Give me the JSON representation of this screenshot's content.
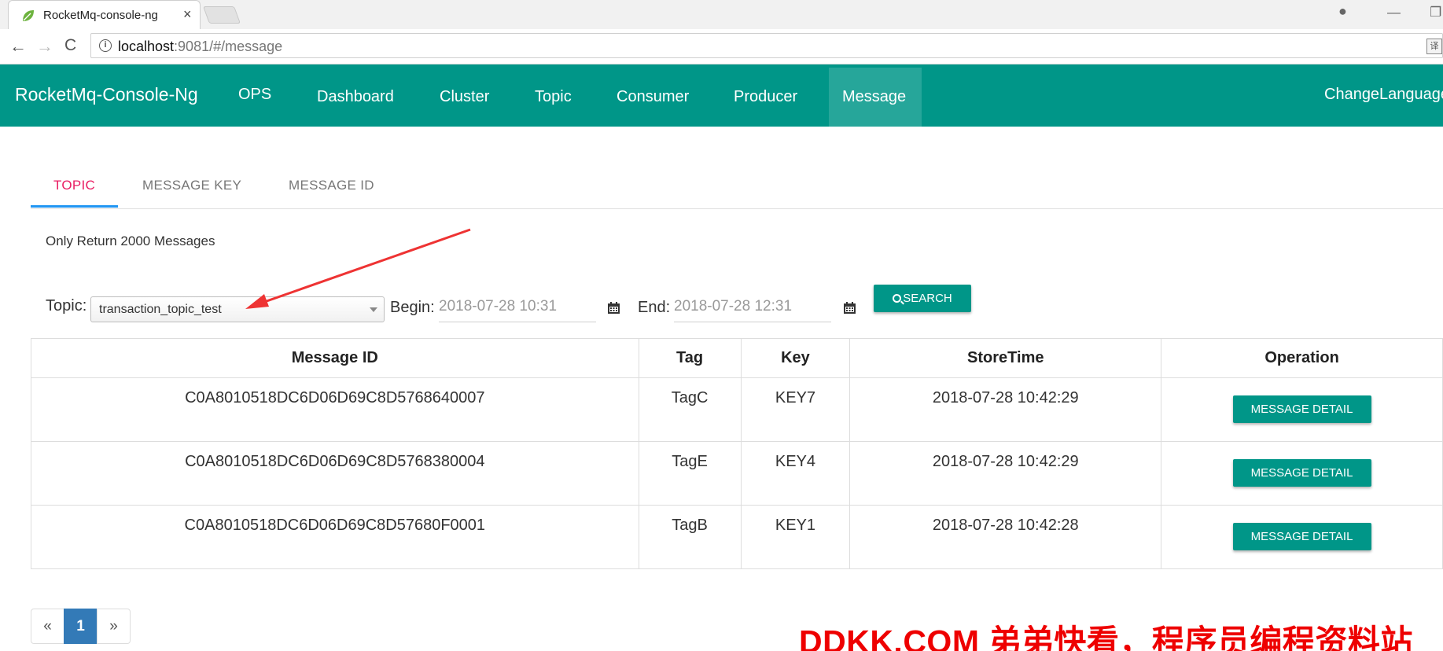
{
  "browser": {
    "tab_title": "RocketMq-console-ng",
    "tab_close": "×",
    "url_host": "localhost",
    "url_path": ":9081/#/message",
    "info_icon": "i",
    "translate_icon": "译",
    "back": "←",
    "forward": "→",
    "reload": "C",
    "minimize": "—",
    "restore": "❐",
    "profile_icon": "●"
  },
  "navbar": {
    "brand": "RocketMq-Console-Ng",
    "items": [
      "OPS",
      "Dashboard",
      "Cluster",
      "Topic",
      "Consumer",
      "Producer",
      "Message"
    ],
    "active": "Message",
    "change_language": "ChangeLanguage"
  },
  "sub_tabs": {
    "items": [
      "TOPIC",
      "MESSAGE KEY",
      "MESSAGE ID"
    ],
    "active": "TOPIC"
  },
  "note": "Only Return 2000 Messages",
  "search": {
    "topic_label": "Topic:",
    "topic_value": "transaction_topic_test",
    "begin_label": "Begin:",
    "begin_value": "2018-07-28 10:31",
    "end_label": "End:",
    "end_value": "2018-07-28 12:31",
    "search_button": "SEARCH"
  },
  "table": {
    "headers": [
      "Message ID",
      "Tag",
      "Key",
      "StoreTime",
      "Operation"
    ],
    "rows": [
      {
        "id": "C0A8010518DC6D06D69C8D5768640007",
        "tag": "TagC",
        "key": "KEY7",
        "time": "2018-07-28 10:42:29",
        "action": "MESSAGE DETAIL"
      },
      {
        "id": "C0A8010518DC6D06D69C8D5768380004",
        "tag": "TagE",
        "key": "KEY4",
        "time": "2018-07-28 10:42:29",
        "action": "MESSAGE DETAIL"
      },
      {
        "id": "C0A8010518DC6D06D69C8D57680F0001",
        "tag": "TagB",
        "key": "KEY1",
        "time": "2018-07-28 10:42:28",
        "action": "MESSAGE DETAIL"
      }
    ]
  },
  "pagination": {
    "prev": "«",
    "current": "1",
    "next": "»"
  },
  "watermark": "DDKK.COM 弟弟快看，程序员编程资料站",
  "colors": {
    "primary": "#009688",
    "active_tab": "#e91e63",
    "tab_underline": "#2196f3",
    "annotation_arrow": "#ee3333",
    "watermark": "#ee0000",
    "page_current": "#337ab7"
  }
}
